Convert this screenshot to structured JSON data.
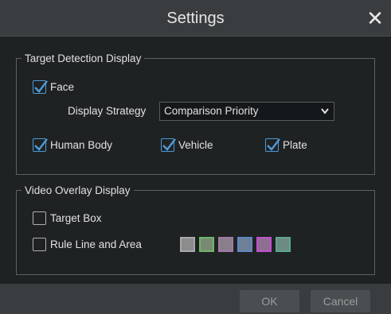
{
  "dialog": {
    "title": "Settings"
  },
  "target_detection": {
    "legend": "Target Detection Display",
    "face": {
      "label": "Face",
      "checked": true
    },
    "display_strategy": {
      "label": "Display Strategy",
      "value": "Comparison Priority"
    },
    "human_body": {
      "label": "Human Body",
      "checked": true
    },
    "vehicle": {
      "label": "Vehicle",
      "checked": true
    },
    "plate": {
      "label": "Plate",
      "checked": true
    }
  },
  "video_overlay": {
    "legend": "Video Overlay Display",
    "target_box": {
      "label": "Target Box",
      "checked": false
    },
    "rule_line": {
      "label": "Rule Line and Area",
      "checked": false
    },
    "color_swatches": [
      {
        "name": "gray",
        "fill": "#8c8c8c",
        "border": "#a8a8a8"
      },
      {
        "name": "green",
        "fill": "#7a8a72",
        "border": "#6db56a"
      },
      {
        "name": "mauve",
        "fill": "#8a7e8a",
        "border": "#a27aa2"
      },
      {
        "name": "blue",
        "fill": "#6e7f96",
        "border": "#5f88c4"
      },
      {
        "name": "magenta",
        "fill": "#8e6f92",
        "border": "#c24fcf"
      },
      {
        "name": "teal",
        "fill": "#6f8a82",
        "border": "#5aa890"
      }
    ]
  },
  "buttons": {
    "ok": "OK",
    "cancel": "Cancel"
  },
  "colors": {
    "accent": "#4d9ad8",
    "background": "#1f2223",
    "bar": "#3a3d3f"
  }
}
